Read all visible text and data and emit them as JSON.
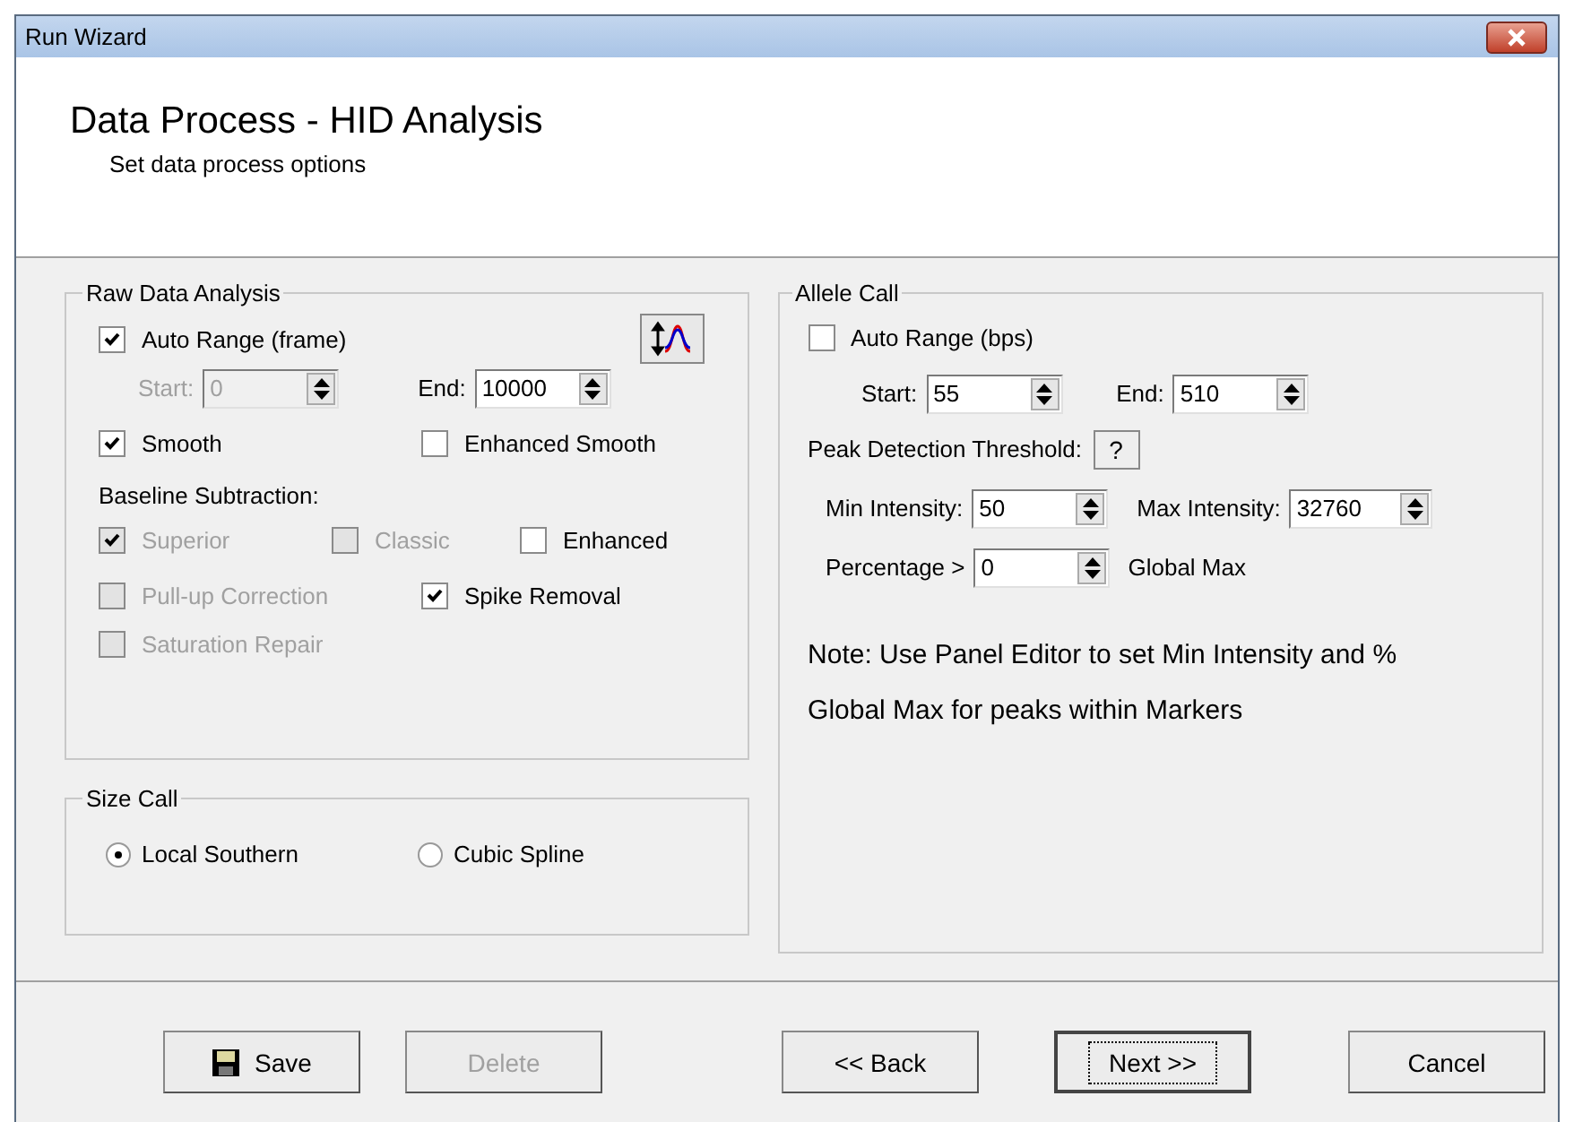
{
  "window": {
    "title": "Run Wizard"
  },
  "header": {
    "title": "Data Process - HID Analysis",
    "subtitle": "Set data process options"
  },
  "raw_data_analysis": {
    "title": "Raw Data Analysis",
    "auto_range": {
      "label": "Auto Range (frame)",
      "checked": true,
      "disabled": false
    },
    "range_fields": [
      {
        "label": "Start:",
        "value": "0",
        "disabled": true
      },
      {
        "label": "End:",
        "value": "10000",
        "disabled": false
      }
    ],
    "smoothing": [
      {
        "label": "Smooth",
        "checked": true,
        "disabled": false
      },
      {
        "label": "Enhanced Smooth",
        "checked": false,
        "disabled": false
      }
    ],
    "baseline_label": "Baseline Subtraction:",
    "baseline": [
      {
        "label": "Superior",
        "checked": true,
        "disabled": true
      },
      {
        "label": "Classic",
        "checked": false,
        "disabled": true
      },
      {
        "label": "Enhanced",
        "checked": false,
        "disabled": false
      }
    ],
    "corrections": [
      {
        "label": "Pull-up Correction",
        "checked": false,
        "disabled": true
      },
      {
        "label": "Spike Removal",
        "checked": true,
        "disabled": false
      }
    ],
    "repairs": [
      {
        "label": "Saturation Repair",
        "checked": false,
        "disabled": true
      }
    ]
  },
  "size_call": {
    "title": "Size Call",
    "options": [
      {
        "label": "Local Southern",
        "selected": true
      },
      {
        "label": "Cubic Spline",
        "selected": false
      }
    ]
  },
  "allele_call": {
    "title": "Allele Call",
    "auto_range": {
      "label": "Auto Range (bps)",
      "checked": false,
      "disabled": false
    },
    "range_fields": [
      {
        "label": "Start:",
        "value": "55",
        "disabled": false
      },
      {
        "label": "End:",
        "value": "510",
        "disabled": false
      }
    ],
    "threshold_label": "Peak Detection Threshold:",
    "help_button": "?",
    "intensity_fields": [
      {
        "label": "Min Intensity:",
        "value": "50",
        "disabled": false
      },
      {
        "label": "Max Intensity:",
        "value": "32760",
        "disabled": false
      }
    ],
    "percentage": {
      "label": "Percentage >",
      "value": "0",
      "disabled": false,
      "suffix": "Global Max"
    },
    "note": "Note: Use Panel Editor to set Min Intensity and % Global Max for peaks within Markers"
  },
  "buttons": [
    {
      "label": "Save",
      "kind": "save",
      "disabled": false,
      "focused": false
    },
    {
      "label": "Delete",
      "kind": "plain",
      "disabled": true,
      "focused": false
    },
    {
      "label": "<< Back",
      "kind": "plain",
      "disabled": false,
      "focused": false
    },
    {
      "label": "Next >>",
      "kind": "plain",
      "disabled": false,
      "focused": true
    },
    {
      "label": "Cancel",
      "kind": "plain",
      "disabled": false,
      "focused": false
    }
  ]
}
